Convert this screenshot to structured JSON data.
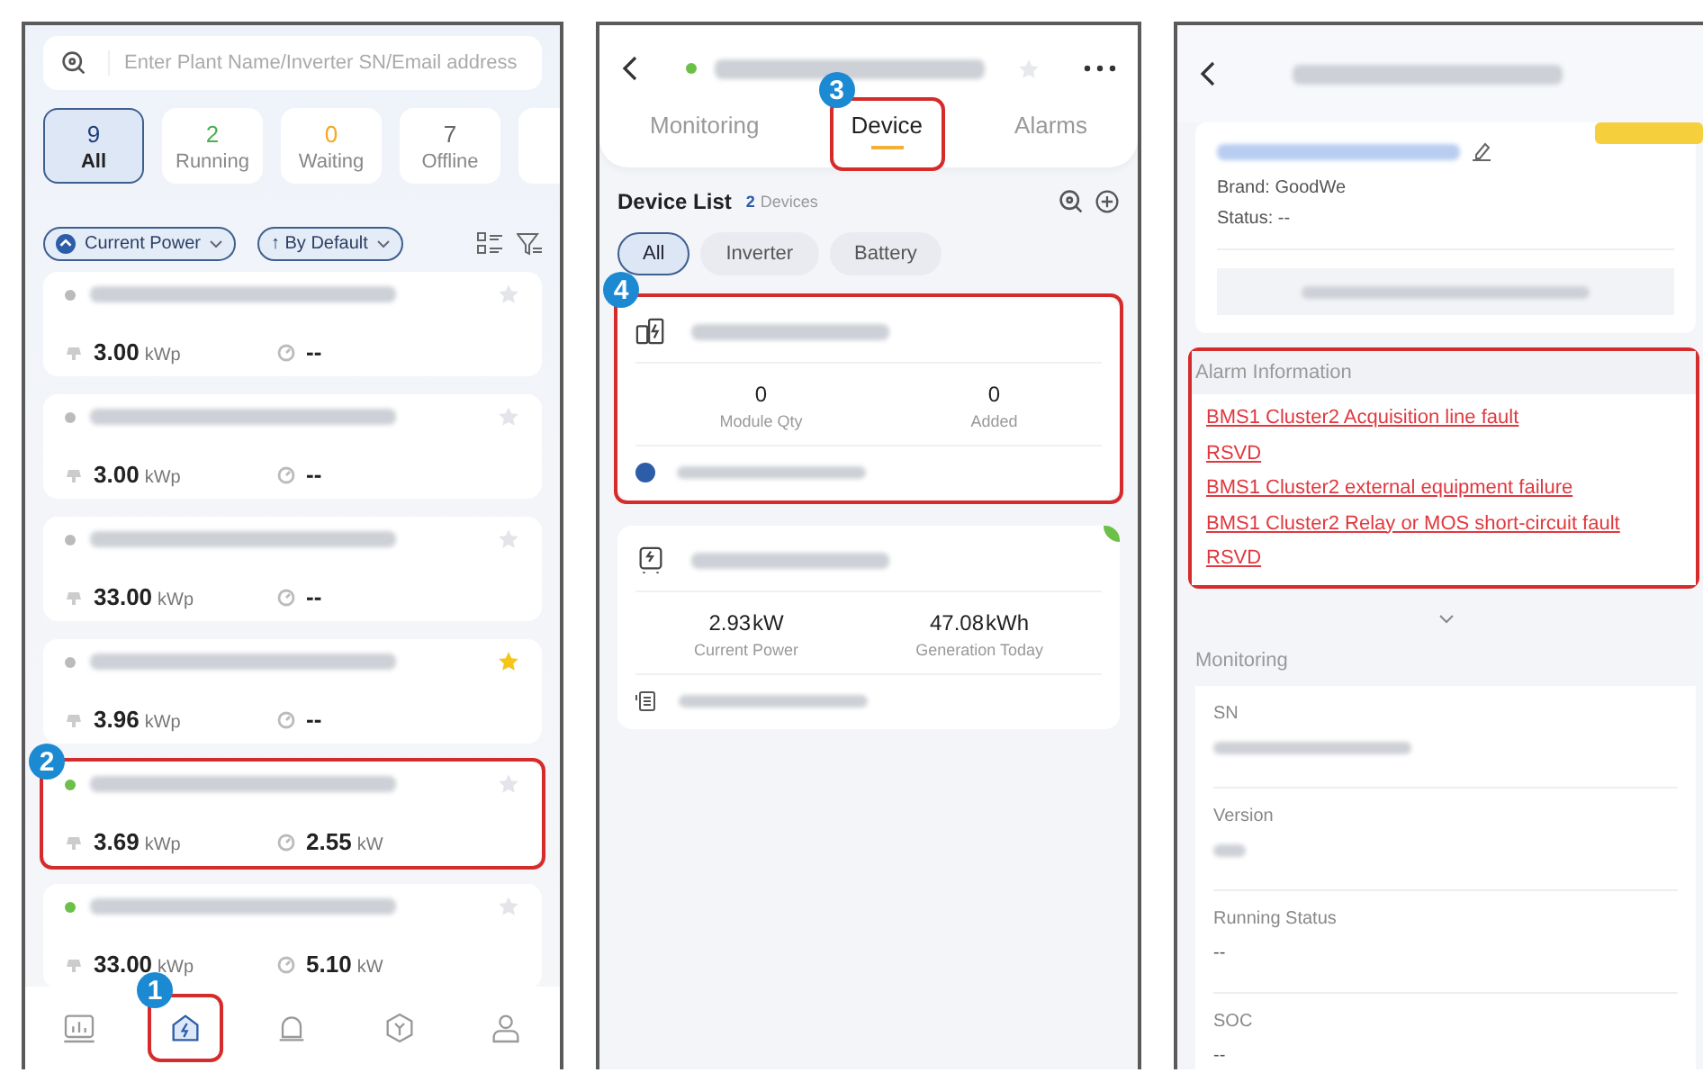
{
  "plant_list": {
    "search": {
      "placeholder": "Enter Plant Name/Inverter SN/Email address"
    },
    "status_tabs": [
      {
        "count": "9",
        "label": "All",
        "selected": true,
        "color": "#1f3f7a"
      },
      {
        "count": "2",
        "label": "Running",
        "selected": false,
        "color": "#4caf50"
      },
      {
        "count": "0",
        "label": "Waiting",
        "selected": false,
        "color": "#f5a623"
      },
      {
        "count": "7",
        "label": "Offline",
        "selected": false,
        "color": "#666666"
      }
    ],
    "filters": [
      {
        "label": "Current Power",
        "kind": "metric"
      },
      {
        "label": "↑ By Default",
        "kind": "sort"
      }
    ],
    "plants": [
      {
        "online": false,
        "favorite": false,
        "capacity": "3.00",
        "capacity_unit": "kWp",
        "power": "--",
        "highlighted": false
      },
      {
        "online": false,
        "favorite": false,
        "capacity": "3.00",
        "capacity_unit": "kWp",
        "power": "--",
        "highlighted": false
      },
      {
        "online": false,
        "favorite": false,
        "capacity": "33.00",
        "capacity_unit": "kWp",
        "power": "--",
        "highlighted": false
      },
      {
        "online": false,
        "favorite": true,
        "capacity": "3.96",
        "capacity_unit": "kWp",
        "power": "--",
        "highlighted": false
      },
      {
        "online": true,
        "favorite": false,
        "capacity": "3.69",
        "capacity_unit": "kWp",
        "power": "2.55",
        "power_unit": "kW",
        "highlighted": true,
        "callout": "2"
      },
      {
        "online": true,
        "favorite": false,
        "capacity": "33.00",
        "capacity_unit": "kWp",
        "power": "5.10",
        "power_unit": "kW",
        "highlighted": false
      }
    ],
    "nav": [
      {
        "kind": "stats",
        "selected": false,
        "highlighted": false
      },
      {
        "kind": "plants",
        "selected": true,
        "highlighted": true,
        "callout": "1"
      },
      {
        "kind": "alarms",
        "selected": false,
        "highlighted": false
      },
      {
        "kind": "devices",
        "selected": false,
        "highlighted": false
      },
      {
        "kind": "account",
        "selected": false,
        "highlighted": false
      }
    ]
  },
  "device_screen": {
    "online": true,
    "tabs": [
      {
        "label": "Monitoring",
        "selected": false,
        "highlighted": false
      },
      {
        "label": "Device",
        "selected": true,
        "highlighted": true,
        "callout": "3"
      },
      {
        "label": "Alarms",
        "selected": false,
        "highlighted": false
      }
    ],
    "list_title": "Device List",
    "device_count": "2",
    "device_count_label": "Devices",
    "chips": [
      {
        "label": "All",
        "selected": true
      },
      {
        "label": "Inverter",
        "selected": false
      },
      {
        "label": "Battery",
        "selected": false
      }
    ],
    "devices": [
      {
        "kind": "battery",
        "highlighted": true,
        "callout": "4",
        "online": false,
        "stats": [
          {
            "value": "0",
            "label": "Module Qty"
          },
          {
            "value": "0",
            "label": "Added"
          }
        ]
      },
      {
        "kind": "inverter",
        "highlighted": false,
        "online": true,
        "stats": [
          {
            "value": "2.93",
            "unit": "kW",
            "label": "Current Power"
          },
          {
            "value": "47.08",
            "unit": "kWh",
            "label": "Generation Today"
          }
        ]
      }
    ]
  },
  "device_detail": {
    "brand": "Brand: GoodWe",
    "status": "Status: --",
    "alarm_title": "Alarm Information",
    "alarms_highlighted": true,
    "alarms": [
      "BMS1 Cluster2 Acquisition line fault",
      "RSVD",
      "BMS1 Cluster2 external equipment failure",
      "BMS1 Cluster2 Relay or MOS short-circuit fault",
      "RSVD"
    ],
    "monitoring_title": "Monitoring",
    "fields": [
      {
        "label": "SN",
        "kind": "redacted"
      },
      {
        "label": "Version",
        "kind": "redacted"
      },
      {
        "label": "Running Status",
        "kind": "text",
        "value": "--"
      },
      {
        "label": "SOC",
        "kind": "text",
        "value": "--"
      }
    ]
  }
}
